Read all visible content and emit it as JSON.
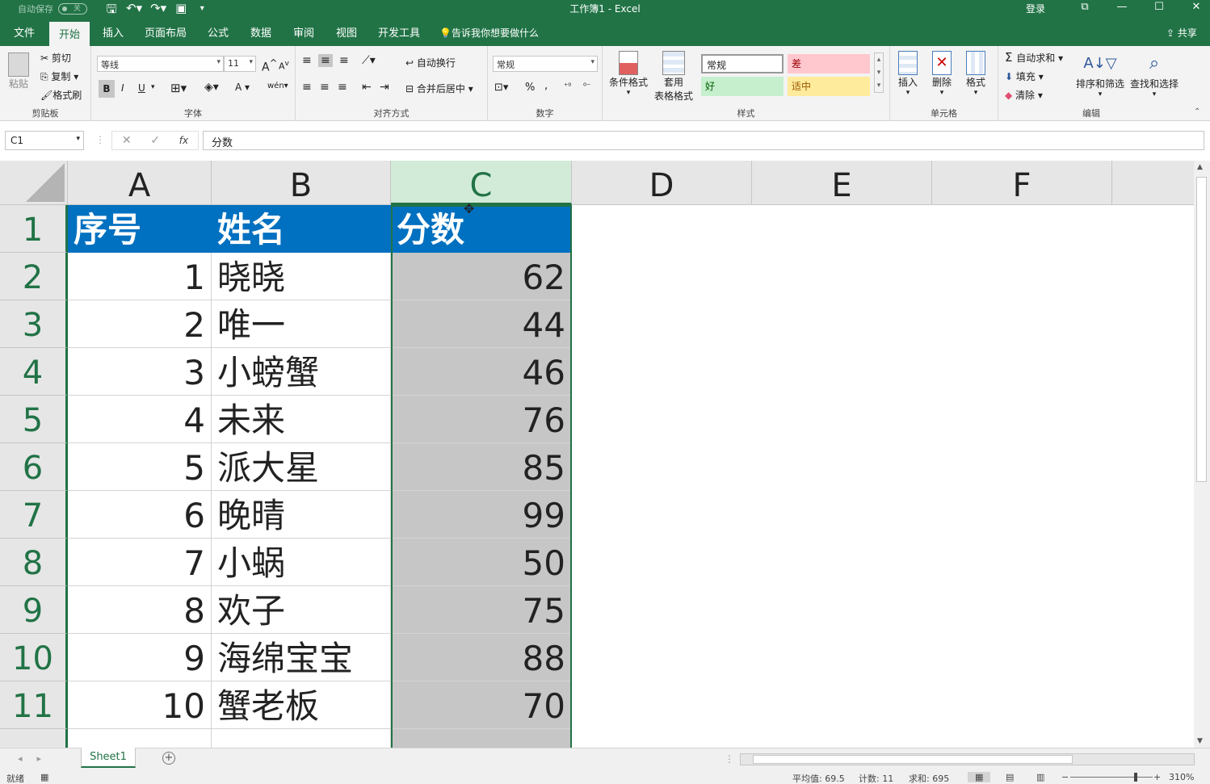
{
  "titlebar": {
    "autosave_label": "自动保存",
    "autosave_state": "关",
    "doc_title": "工作簿1  -  Excel",
    "login": "登录",
    "icons": [
      "save-icon",
      "undo-icon",
      "redo-icon",
      "form-icon",
      "customize-icon"
    ]
  },
  "tabs": {
    "file": "文件",
    "home": "开始",
    "insert": "插入",
    "page_layout": "页面布局",
    "formulas": "公式",
    "data": "数据",
    "review": "审阅",
    "view": "视图",
    "developer": "开发工具",
    "tellme": "告诉我你想要做什么",
    "share": "共享"
  },
  "ribbon": {
    "clipboard": {
      "paste": "粘贴",
      "cut": "剪切",
      "copy": "复制",
      "format_painter": "格式刷",
      "label": "剪贴板"
    },
    "font": {
      "name": "等线",
      "size": "11",
      "bold": "B",
      "italic": "I",
      "underline": "U",
      "grow": "A",
      "shrink": "A",
      "font_color": "A",
      "phonetic": "wén",
      "label": "字体"
    },
    "alignment": {
      "wrap": "自动换行",
      "merge": "合并后居中",
      "label": "对齐方式"
    },
    "number": {
      "format": "常规",
      "label": "数字"
    },
    "styles": {
      "conditional": "条件格式",
      "table_format_1": "套用",
      "table_format_2": "表格格式",
      "normal": "常规",
      "bad": "差",
      "good": "好",
      "neutral": "适中",
      "label": "样式"
    },
    "cells": {
      "insert": "插入",
      "delete": "删除",
      "format": "格式",
      "label": "单元格"
    },
    "editing": {
      "autosum": "自动求和",
      "fill": "填充",
      "clear": "清除",
      "sort": "排序和筛选",
      "find": "查找和选择",
      "label": "编辑"
    },
    "colors": {
      "normal_bg": "#ffffff",
      "bad_bg": "#ffc7ce",
      "bad_fg": "#9c0006",
      "good_bg": "#c6efce",
      "good_fg": "#006100",
      "neutral_bg": "#ffeb9c",
      "neutral_fg": "#9c5700"
    }
  },
  "formula_bar": {
    "name_box": "C1",
    "cancel": "✕",
    "enter": "✓",
    "fx": "fx",
    "content": "分数"
  },
  "sheet": {
    "columns": [
      "A",
      "B",
      "C",
      "D",
      "E",
      "F"
    ],
    "selected_column": "C",
    "header_row": [
      "序号",
      "姓名",
      "分数"
    ],
    "rows": [
      {
        "row": "2",
        "a": "1",
        "b": "晓晓",
        "c": "62"
      },
      {
        "row": "3",
        "a": "2",
        "b": "唯一",
        "c": "44"
      },
      {
        "row": "4",
        "a": "3",
        "b": "小螃蟹",
        "c": "46"
      },
      {
        "row": "5",
        "a": "4",
        "b": "未来",
        "c": "76"
      },
      {
        "row": "6",
        "a": "5",
        "b": "派大星",
        "c": "85"
      },
      {
        "row": "7",
        "a": "6",
        "b": "晚晴",
        "c": "99"
      },
      {
        "row": "8",
        "a": "7",
        "b": "小蜗",
        "c": "50"
      },
      {
        "row": "9",
        "a": "8",
        "b": "欢子",
        "c": "75"
      },
      {
        "row": "10",
        "a": "9",
        "b": "海绵宝宝",
        "c": "88"
      },
      {
        "row": "11",
        "a": "10",
        "b": "蟹老板",
        "c": "70"
      }
    ],
    "row1_label": "1",
    "header_fill": "#0070c0",
    "selection_color": "#217346"
  },
  "sheet_tabs": {
    "active": "Sheet1",
    "add": "+"
  },
  "statusbar": {
    "ready": "就绪",
    "average": "平均值: 69.5",
    "count": "计数: 11",
    "sum": "求和: 695",
    "zoom": "310%"
  }
}
